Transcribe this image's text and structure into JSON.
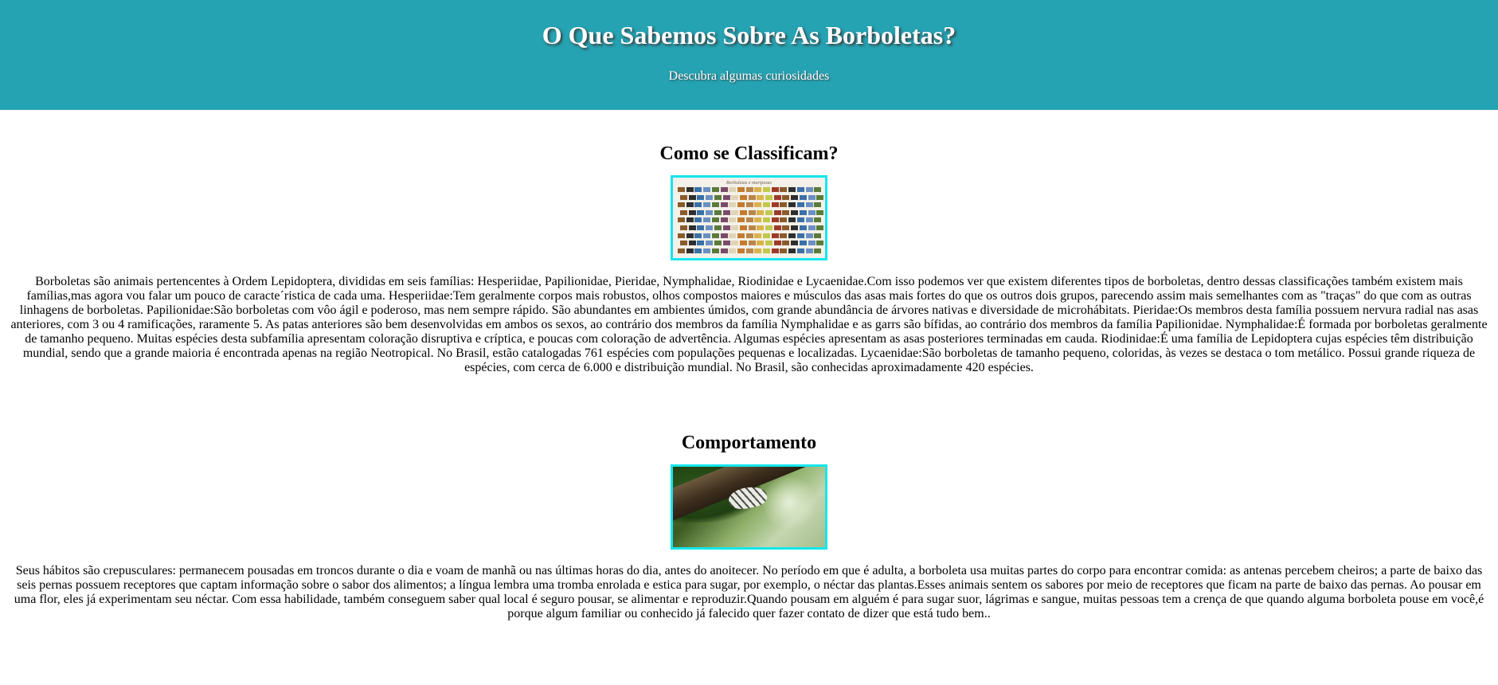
{
  "header": {
    "title": "O Que Sabemos Sobre As Borboletas?",
    "subtitle": "Descubra algumas curiosidades"
  },
  "sections": [
    {
      "title": "Como se Classificam?",
      "image": {
        "alt": "butterfly-classification-chart",
        "caption": "Borboletas e mariposas"
      },
      "text": "Borboletas são animais pertencentes à Ordem Lepidoptera, divididas em seis famílias: Hesperiidae, Papilionidae, Pieridae, Nymphalidae, Riodinidae e Lycaenidae.Com isso podemos ver que existem diferentes tipos de borboletas, dentro dessas classificações também existem mais famílias,mas agora vou falar um pouco de caracte´ristica de cada uma. Hesperiidae:Tem geralmente corpos mais robustos, olhos compostos maiores e músculos das asas mais fortes do que os outros dois grupos, parecendo assim mais semelhantes com as \"traças\" do que com as outras linhagens de borboletas. Papilionidae:São borboletas com vôo ágil e poderoso, mas nem sempre rápido. São abundantes em ambientes úmidos, com grande abundância de árvores nativas e diversidade de microhábitats. Pieridae:Os membros desta família possuem nervura radial nas asas anteriores, com 3 ou 4 ramificações, raramente 5. As patas anteriores são bem desenvolvidas em ambos os sexos, ao contrário dos membros da família Nymphalidae e as garrs são bífidas, ao contrário dos membros da família Papilionidae. Nymphalidae:É formada por borboletas geralmente de tamanho pequeno. Muitas espécies desta subfamília apresentam coloração disruptiva e críptica, e poucas com coloração de advertência. Algumas espécies apresentam as asas posteriores terminadas em cauda. Riodinidae:É uma família de Lepidoptera cujas espécies têm distribuição mundial, sendo que a grande maioria é encontrada apenas na região Neotropical. No Brasil, estão catalogadas 761 espécies com populações pequenas e localizadas. Lycaenidae:São borboletas de tamanho pequeno, coloridas, às vezes se destaca o tom metálico. Possui grande riqueza de espécies, com cerca de 6.000 e distribuição mundial. No Brasil, são conhecidas aproximadamente 420 espécies."
    },
    {
      "title": "Comportamento",
      "image": {
        "alt": "butterfly-on-tree-trunk-photo"
      },
      "text": "Seus hábitos são crepusculares: permanecem pousadas em troncos durante o dia e voam de manhã ou nas últimas horas do dia, antes do anoitecer. No período em que é adulta, a borboleta usa muitas partes do corpo para encontrar comida: as antenas percebem cheiros; a parte de baixo das seis pernas possuem receptores que captam informação sobre o sabor dos alimentos; a língua lembra uma tromba enrolada e estica para sugar, por exemplo, o néctar das plantas.Esses animais sentem os sabores por meio de receptores que ficam na parte de baixo das pernas. Ao pousar em uma flor, eles já experimentam seu néctar. Com essa habilidade, também conseguem saber qual local é seguro pousar, se alimentar e reproduzir.Quando pousam em alguém é para sugar suor, lágrimas e sangue, muitas pessoas tem a crença de que quando alguma borboleta pouse em você,é porque algum familiar ou conhecido já falecido quer fazer contato de dizer que está tudo bem.."
    }
  ],
  "colors": {
    "header_bg": "#25a3b3",
    "image_border": "#14e6ec",
    "header_text": "#ffffff"
  }
}
